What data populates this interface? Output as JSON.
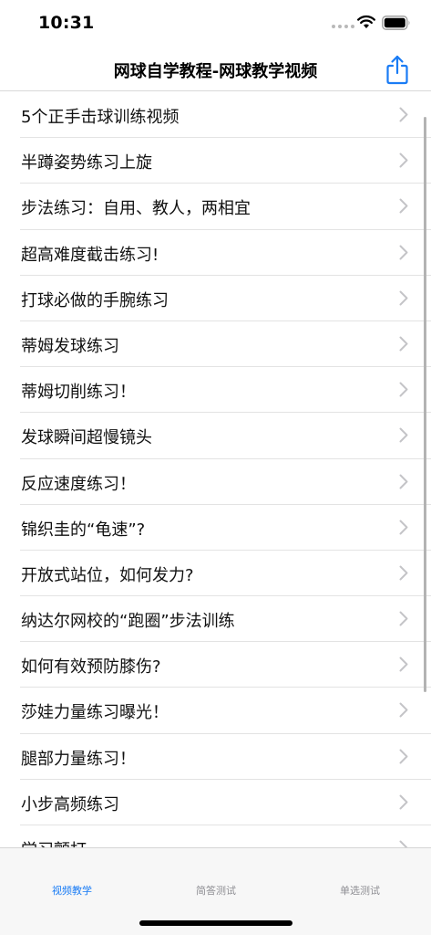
{
  "status_bar": {
    "time": "10:31",
    "icons": [
      "signal-dots-icon",
      "wifi-icon",
      "battery-icon"
    ]
  },
  "nav": {
    "title": "网球自学教程-网球教学视频",
    "share_icon": "share-icon"
  },
  "list": {
    "items": [
      {
        "label": "5个正手击球训练视频"
      },
      {
        "label": "半蹲姿势练习上旋"
      },
      {
        "label": "步法练习：自用、教人，两相宜"
      },
      {
        "label": "超高难度截击练习!"
      },
      {
        "label": "打球必做的手腕练习"
      },
      {
        "label": "蒂姆发球练习"
      },
      {
        "label": "蒂姆切削练习！"
      },
      {
        "label": "发球瞬间超慢镜头"
      },
      {
        "label": "反应速度练习！"
      },
      {
        "label": "锦织圭的“龟速”?"
      },
      {
        "label": "开放式站位，如何发力?"
      },
      {
        "label": "纳达尔网校的“跑圈”步法训练"
      },
      {
        "label": "如何有效预防膝伤?"
      },
      {
        "label": "莎娃力量练习曝光！"
      },
      {
        "label": "腿部力量练习！"
      },
      {
        "label": "小步高频练习"
      },
      {
        "label": "学习颤打"
      }
    ],
    "chevron_icon": "chevron-right-icon"
  },
  "tab_bar": {
    "tabs": [
      {
        "label": "视频教学",
        "active": true
      },
      {
        "label": "简答测试",
        "active": false
      },
      {
        "label": "单选测试",
        "active": false
      }
    ]
  },
  "colors": {
    "accent": "#1a7cf5",
    "inactive_tab": "#8e8e93",
    "separator": "#e3e3e3",
    "chevron": "#c4c4c7"
  }
}
